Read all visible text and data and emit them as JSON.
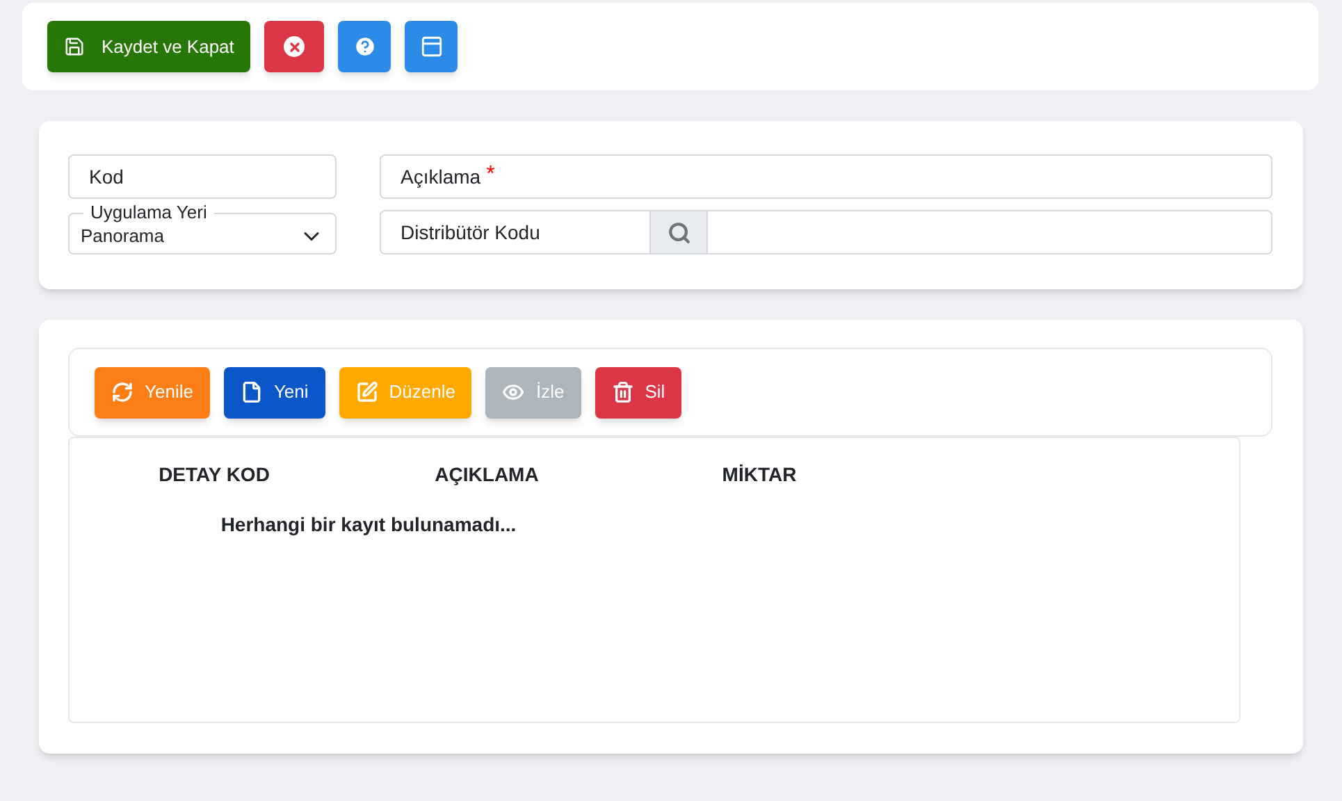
{
  "toolbar": [
    {
      "kind": "save",
      "label": "Kaydet ve Kapat"
    },
    {
      "kind": "close"
    },
    {
      "kind": "help"
    },
    {
      "kind": "window"
    }
  ],
  "form": {
    "kod": {
      "placeholder": "Kod"
    },
    "uygulama_yeri": {
      "label": "Uygulama Yeri",
      "value": "Panorama"
    },
    "aciklama": {
      "placeholder": "Açıklama",
      "required": true,
      "required_mark": "*"
    },
    "distributor_kodu": {
      "label": "Distribütör Kodu"
    }
  },
  "grid": {
    "buttons": [
      {
        "kind": "refresh",
        "label": "Yenile",
        "disabled": false
      },
      {
        "kind": "new",
        "label": "Yeni",
        "disabled": false
      },
      {
        "kind": "edit",
        "label": "Düzenle",
        "disabled": false
      },
      {
        "kind": "view",
        "label": "İzle",
        "disabled": true
      },
      {
        "kind": "delete",
        "label": "Sil",
        "disabled": false
      }
    ],
    "columns": [
      "DETAY KOD",
      "AÇIKLAMA",
      "MİKTAR"
    ],
    "empty_message": "Herhangi bir kayıt bulunamadı..."
  }
}
